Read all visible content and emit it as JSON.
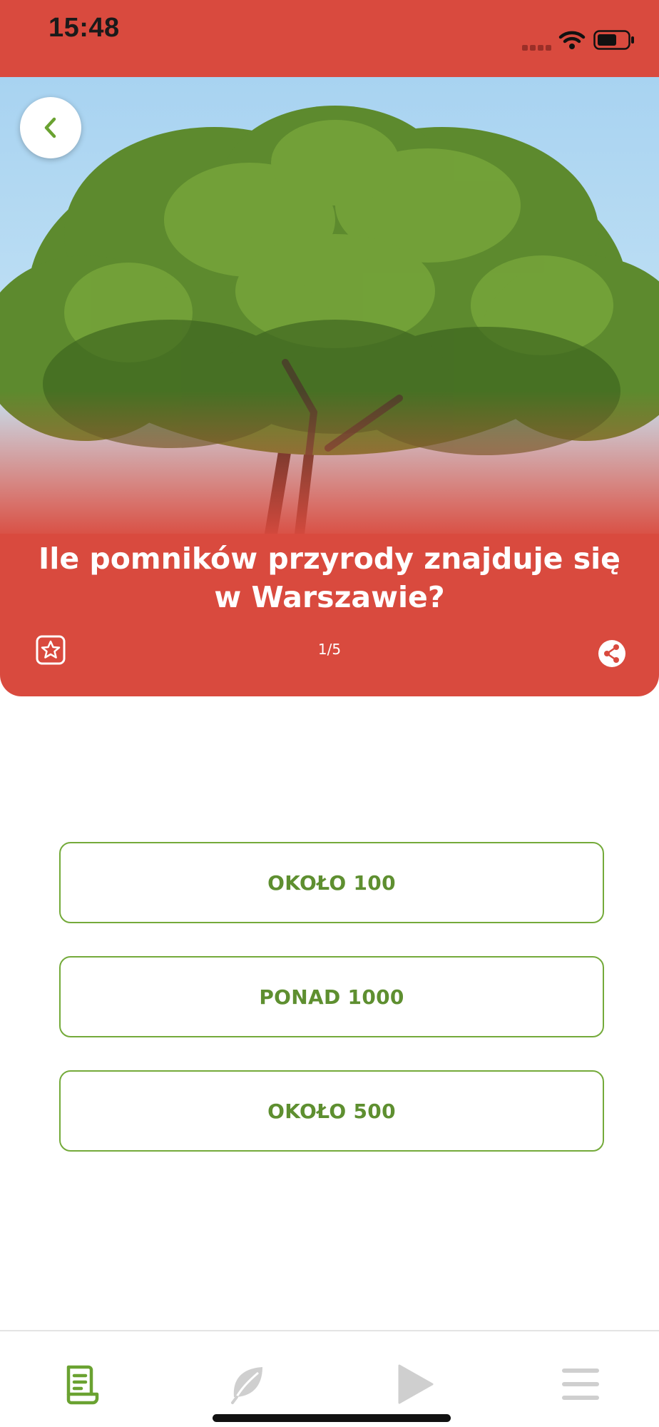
{
  "status_bar": {
    "time": "15:48",
    "icons": [
      "signal-icon",
      "wifi-icon",
      "battery-icon"
    ]
  },
  "header": {
    "back_icon": "chevron-left-icon",
    "image": "oak-tree-photo",
    "question": "Ile pomników przyrody znajduje się w Warszawie?",
    "progress": "1/5",
    "favorite_icon": "star-badge-icon",
    "share_icon": "share-icon"
  },
  "answers": [
    {
      "label": "OKOŁO 100"
    },
    {
      "label": "PONAD 1000"
    },
    {
      "label": "OKOŁO 500"
    }
  ],
  "tab_bar": {
    "tabs": [
      {
        "icon": "document-icon",
        "active": true
      },
      {
        "icon": "leaf-icon",
        "active": false
      },
      {
        "icon": "play-icon",
        "active": false
      },
      {
        "icon": "menu-icon",
        "active": false
      }
    ]
  },
  "colors": {
    "brand_red": "#d94a3e",
    "accent_green": "#6aa231",
    "inactive_gray": "#c8c8c8"
  }
}
